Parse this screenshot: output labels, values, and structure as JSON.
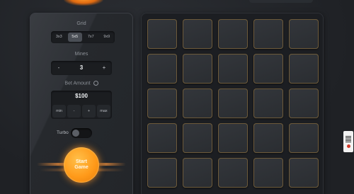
{
  "panel": {
    "grid_label": "Grid",
    "grid_options": [
      "3x3",
      "5x5",
      "7x7",
      "9x9"
    ],
    "grid_selected": "5x5",
    "mines_label": "Mines",
    "mines_minus": "-",
    "mines_value": "3",
    "mines_plus": "+",
    "bet_label": "Bet Amount",
    "bet_info_icon": "info-icon",
    "bet_amount": "$100",
    "bet_buttons": [
      "min",
      "-",
      "+",
      "max"
    ],
    "turbo_label": "Turbo",
    "turbo_on": false,
    "start_label": "Start Game"
  },
  "board": {
    "rows": 5,
    "cols": 5
  },
  "colors": {
    "accent": "#ff9a1a",
    "tile_border": "#6d5a3a",
    "panel_bg": "#26292d",
    "board_bg": "#1c1e22"
  }
}
